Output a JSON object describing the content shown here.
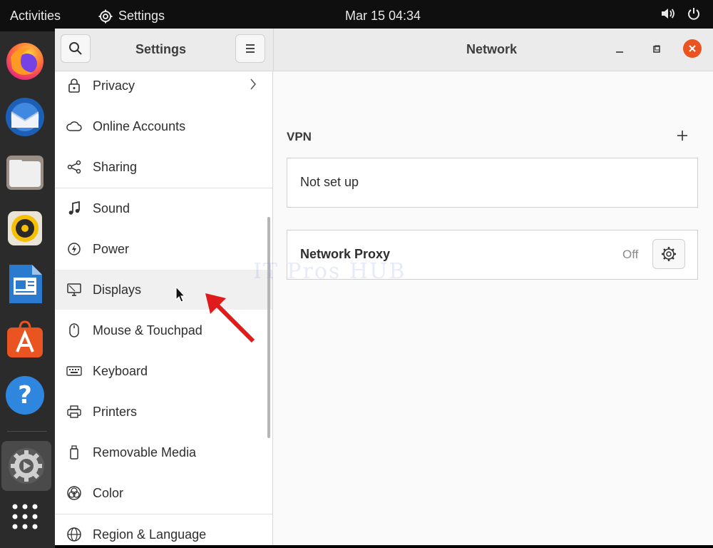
{
  "topbar": {
    "activities": "Activities",
    "app_name": "Settings",
    "clock": "Mar 15  04:34"
  },
  "dock": {
    "apps": [
      "firefox-icon",
      "thunderbird-icon",
      "files-icon",
      "rhythmbox-icon",
      "libreoffice-writer-icon",
      "ubuntu-software-icon",
      "help-icon",
      "settings-icon",
      "show-apps-icon"
    ]
  },
  "sidebar": {
    "title": "Settings",
    "items": [
      {
        "label": "Privacy",
        "icon": "lock-icon"
      },
      {
        "label": "Online Accounts",
        "icon": "cloud-icon"
      },
      {
        "label": "Sharing",
        "icon": "share-icon"
      },
      {
        "label": "Sound",
        "icon": "music-note-icon"
      },
      {
        "label": "Power",
        "icon": "power-icon"
      },
      {
        "label": "Displays",
        "icon": "display-icon"
      },
      {
        "label": "Mouse & Touchpad",
        "icon": "mouse-icon"
      },
      {
        "label": "Keyboard",
        "icon": "keyboard-icon"
      },
      {
        "label": "Printers",
        "icon": "printer-icon"
      },
      {
        "label": "Removable Media",
        "icon": "removable-media-icon"
      },
      {
        "label": "Color",
        "icon": "color-icon"
      },
      {
        "label": "Region & Language",
        "icon": "globe-icon"
      }
    ]
  },
  "main": {
    "title": "Network",
    "vpn": {
      "title": "VPN",
      "status": "Not set up"
    },
    "proxy": {
      "label": "Network Proxy",
      "status": "Off"
    }
  },
  "watermark": "IT Pros HUB",
  "colors": {
    "close_button": "#e95420",
    "annotation_arrow": "#e01b1b"
  }
}
